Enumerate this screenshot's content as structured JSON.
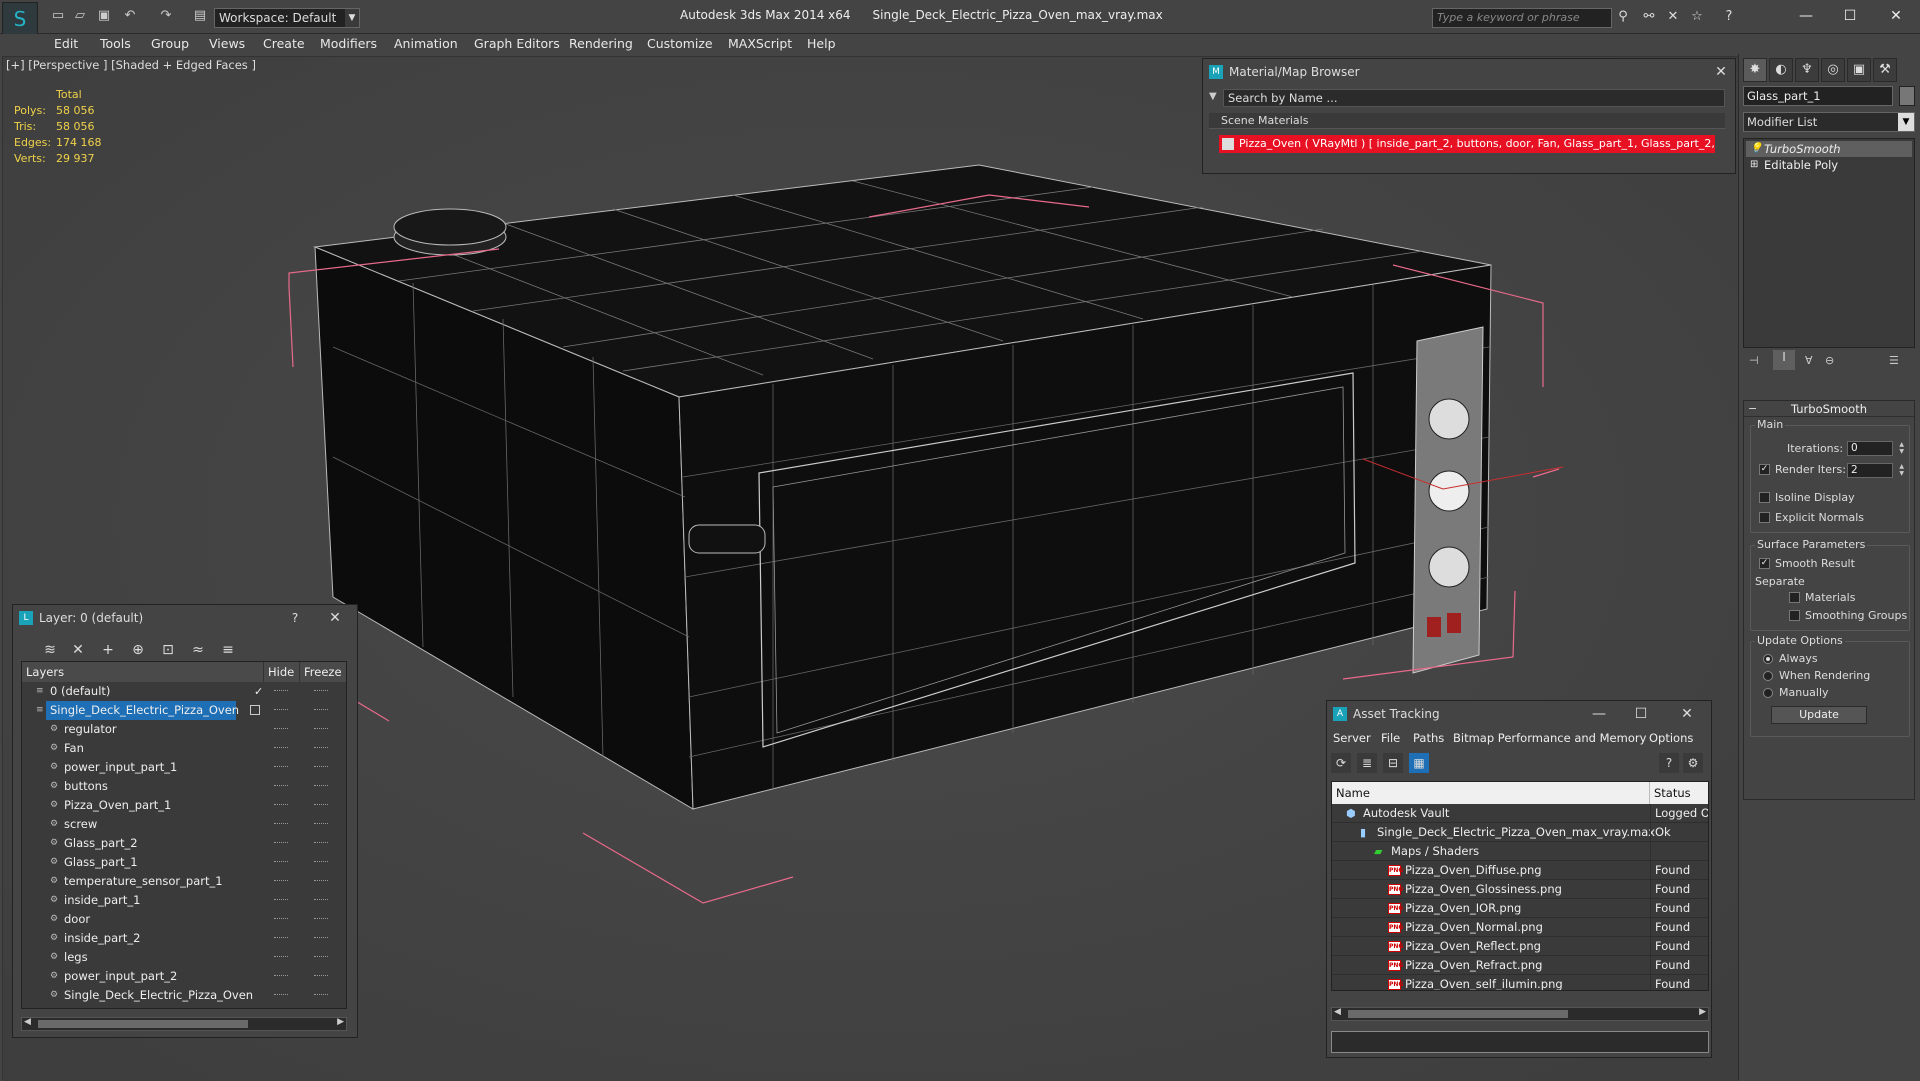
{
  "titlebar": {
    "workspace": "Workspace: Default",
    "app_name": "Autodesk 3ds Max  2014 x64",
    "file_name": "Single_Deck_Electric_Pizza_Oven_max_vray.max",
    "search_placeholder": "Type a keyword or phrase"
  },
  "menu": [
    "Edit",
    "Tools",
    "Group",
    "Views",
    "Create",
    "Modifiers",
    "Animation",
    "Graph Editors",
    "Rendering",
    "Customize",
    "MAXScript",
    "Help"
  ],
  "viewport": {
    "label": "[+] [Perspective ] [Shaded + Edged Faces ]",
    "stats_header": "Total",
    "stats": [
      {
        "label": "Polys:",
        "value": "58 056"
      },
      {
        "label": "Tris:",
        "value": "58 056"
      },
      {
        "label": "Edges:",
        "value": "174 168"
      },
      {
        "label": "Verts:",
        "value": "29 937"
      }
    ]
  },
  "material_browser": {
    "title": "Material/Map Browser",
    "search": "Search by Name ...",
    "section": "Scene Materials",
    "item": "Pizza_Oven  ( VRayMtl )  [ inside_part_2, buttons, door, Fan, Glass_part_1, Glass_part_2, i..."
  },
  "command_panel": {
    "object_name": "Glass_part_1",
    "modifier_list": "Modifier List",
    "stack": [
      "TurboSmooth",
      "Editable Poly"
    ],
    "rollout_title": "TurboSmooth",
    "main_group": "Main",
    "iterations_label": "Iterations:",
    "iterations_value": "0",
    "render_iters_label": "Render Iters:",
    "render_iters_value": "2",
    "isoline": "Isoline Display",
    "explicit_normals": "Explicit Normals",
    "surface_group": "Surface Parameters",
    "smooth_result": "Smooth Result",
    "separate": "Separate",
    "materials": "Materials",
    "smoothing_groups": "Smoothing Groups",
    "update_group": "Update Options",
    "always": "Always",
    "when_rendering": "When Rendering",
    "manually": "Manually",
    "update_button": "Update"
  },
  "layer_window": {
    "title": "Layer: 0 (default)",
    "help": "?",
    "col_layers": "Layers",
    "col_hide": "Hide",
    "col_freeze": "Freeze",
    "rows": [
      {
        "name": "0 (default)",
        "level": 0,
        "selected": false
      },
      {
        "name": "Single_Deck_Electric_Pizza_Oven",
        "level": 0,
        "selected": true
      },
      {
        "name": "regulator",
        "level": 1,
        "selected": false
      },
      {
        "name": "Fan",
        "level": 1,
        "selected": false
      },
      {
        "name": "power_input_part_1",
        "level": 1,
        "selected": false
      },
      {
        "name": "buttons",
        "level": 1,
        "selected": false
      },
      {
        "name": "Pizza_Oven_part_1",
        "level": 1,
        "selected": false
      },
      {
        "name": "screw",
        "level": 1,
        "selected": false
      },
      {
        "name": "Glass_part_2",
        "level": 1,
        "selected": false
      },
      {
        "name": "Glass_part_1",
        "level": 1,
        "selected": false
      },
      {
        "name": "temperature_sensor_part_1",
        "level": 1,
        "selected": false
      },
      {
        "name": "inside_part_1",
        "level": 1,
        "selected": false
      },
      {
        "name": "door",
        "level": 1,
        "selected": false
      },
      {
        "name": " inside_part_2",
        "level": 1,
        "selected": false
      },
      {
        "name": "legs",
        "level": 1,
        "selected": false
      },
      {
        "name": "power_input_part_2",
        "level": 1,
        "selected": false
      },
      {
        "name": "Single_Deck_Electric_Pizza_Oven",
        "level": 1,
        "selected": false
      }
    ]
  },
  "asset_tracking": {
    "title": "Asset Tracking",
    "menu": [
      "Server",
      "File",
      "Paths",
      "Bitmap Performance and Memory",
      "Options"
    ],
    "col_name": "Name",
    "col_status": "Status",
    "rows": [
      {
        "name": "Autodesk Vault",
        "status": "Logged O",
        "indent": 1,
        "icon": "vault"
      },
      {
        "name": "Single_Deck_Electric_Pizza_Oven_max_vray.max",
        "status": "Ok",
        "indent": 2,
        "icon": "max"
      },
      {
        "name": "Maps / Shaders",
        "status": "",
        "indent": 3,
        "icon": "maps"
      },
      {
        "name": "Pizza_Oven_Diffuse.png",
        "status": "Found",
        "indent": 4,
        "icon": "png"
      },
      {
        "name": "Pizza_Oven_Glossiness.png",
        "status": "Found",
        "indent": 4,
        "icon": "png"
      },
      {
        "name": "Pizza_Oven_IOR.png",
        "status": "Found",
        "indent": 4,
        "icon": "png"
      },
      {
        "name": "Pizza_Oven_Normal.png",
        "status": "Found",
        "indent": 4,
        "icon": "png"
      },
      {
        "name": "Pizza_Oven_Reflect.png",
        "status": "Found",
        "indent": 4,
        "icon": "png"
      },
      {
        "name": "Pizza_Oven_Refract.png",
        "status": "Found",
        "indent": 4,
        "icon": "png"
      },
      {
        "name": "Pizza_Oven_self_ilumin.png",
        "status": "Found",
        "indent": 4,
        "icon": "png"
      }
    ]
  },
  "icons": {
    "png_badge": "PNG"
  }
}
